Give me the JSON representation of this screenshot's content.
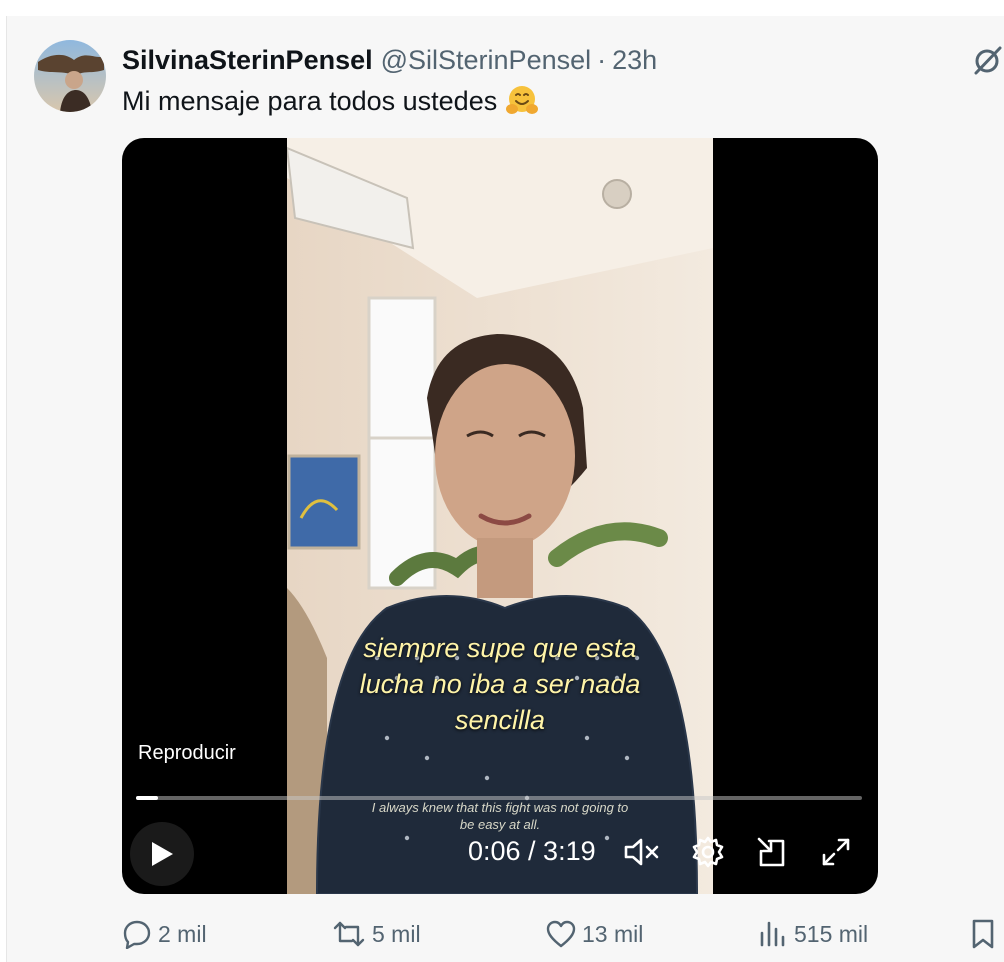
{
  "tweet": {
    "author_name": "SilvinaSterinPensel",
    "handle": "@SilSterinPensel",
    "separator": "·",
    "time": "23h",
    "text": "Mi mensaje para todos ustedes",
    "emoji_icon": "hugging-face-icon"
  },
  "video": {
    "caption_lines": [
      "siempre supe que esta",
      "lucha no iba a ser nada",
      "sencilla"
    ],
    "subtitle_lines": [
      "I always knew that this fight was not going to",
      "be easy at all."
    ],
    "play_label": "Reproducir",
    "progress": 0.03,
    "timer": "0:06 / 3:19",
    "icons": [
      "play-icon",
      "muted-speaker-icon",
      "settings-gear-icon",
      "picture-in-picture-icon",
      "fullscreen-icon"
    ]
  },
  "actions": {
    "replies": "2 mil",
    "reposts": "5 mil",
    "likes": "13 mil",
    "views": "515 mil"
  },
  "colors": {
    "secondary_text": "#536471",
    "caption": "#fff4a8",
    "background": "#f7f7f7"
  }
}
